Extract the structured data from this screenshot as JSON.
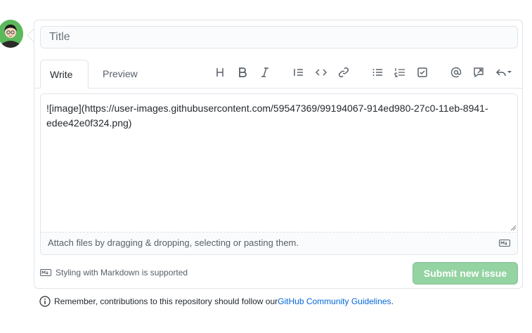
{
  "form": {
    "title_placeholder": "Title",
    "title_value": ""
  },
  "tabs": [
    {
      "label": "Write"
    },
    {
      "label": "Preview"
    }
  ],
  "toolbar": {
    "icons": [
      "heading-icon",
      "bold-icon",
      "italic-icon",
      "quote-icon",
      "code-icon",
      "link-icon",
      "bulleted-list-icon",
      "numbered-list-icon",
      "task-list-icon",
      "mention-icon",
      "reference-icon",
      "reply-icon"
    ]
  },
  "editor": {
    "content": "![image](https://user-images.githubusercontent.com/59547369/99194067-914ed980-27c0-11eb-8941-edee42e0f324.png)",
    "attach_hint": "Attach files by dragging & dropping, selecting or pasting them."
  },
  "footer": {
    "markdown_note": "Styling with Markdown is supported",
    "submit_label": "Submit new issue"
  },
  "reminder": {
    "text": "Remember, contributions to this repository should follow our ",
    "link": "GitHub Community Guidelines",
    "suffix": "."
  },
  "colors": {
    "submit_disabled": "#94d3a2",
    "link": "#0366d6",
    "avatar_bg": "#5cb85c"
  }
}
